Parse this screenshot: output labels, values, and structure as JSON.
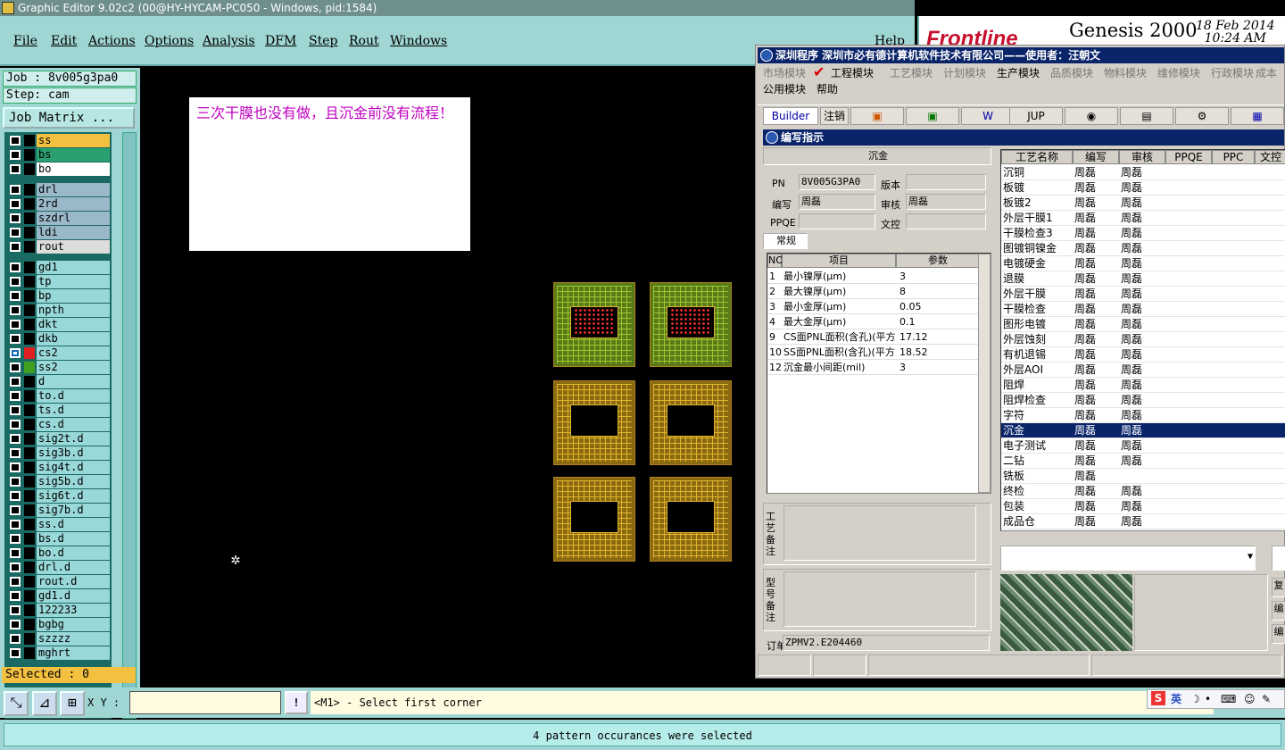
{
  "window": {
    "title": "Graphic Editor 9.02c2 (00@HY-HYCAM-PC050 - Windows, pid:1584)"
  },
  "menu": {
    "items": [
      "File",
      "Edit",
      "Actions",
      "Options",
      "Analysis",
      "DFM",
      "Step",
      "Rout",
      "Windows"
    ],
    "help": "Help"
  },
  "logo": {
    "brand": "Frontline",
    "product": "Genesis 2000",
    "date": "18 Feb 2014",
    "time": "10:24 AM"
  },
  "job": {
    "job_label": "Job : 8v005g3pa0",
    "step_label": "Step: cam",
    "matrix_button": "Job Matrix ..."
  },
  "layers": [
    {
      "name": "ss",
      "color": "#000000",
      "name_bg": "#f4c040"
    },
    {
      "name": "bs",
      "color": "#000000",
      "name_bg": "#2aa070"
    },
    {
      "name": "bo",
      "color": "#000000",
      "name_bg": "#ffffff"
    },
    {
      "name": "drl",
      "color": "#000000",
      "name_bg": "#9ab8c8"
    },
    {
      "name": "2rd",
      "color": "#000000",
      "name_bg": "#9ab8c8"
    },
    {
      "name": "szdrl",
      "color": "#000000",
      "name_bg": "#9ab8c8"
    },
    {
      "name": "ldi",
      "color": "#000000",
      "name_bg": "#9ab8c8"
    },
    {
      "name": "rout",
      "color": "#000000",
      "name_bg": "#dddddd"
    },
    {
      "name": "gd1",
      "color": "#000000",
      "name_bg": "#99d8d8"
    },
    {
      "name": "tp",
      "color": "#000000",
      "name_bg": "#99d8d8"
    },
    {
      "name": "bp",
      "color": "#000000",
      "name_bg": "#99d8d8"
    },
    {
      "name": "npth",
      "color": "#000000",
      "name_bg": "#99d8d8"
    },
    {
      "name": "dkt",
      "color": "#000000",
      "name_bg": "#99d8d8"
    },
    {
      "name": "dkb",
      "color": "#000000",
      "name_bg": "#99d8d8"
    },
    {
      "name": "cs2",
      "color": "#e02020",
      "name_bg": "#99d8d8",
      "selected": true
    },
    {
      "name": "ss2",
      "color": "#40a020",
      "name_bg": "#99d8d8"
    },
    {
      "name": "d",
      "color": "#000000",
      "name_bg": "#99d8d8"
    },
    {
      "name": "to.d",
      "color": "#000000",
      "name_bg": "#99d8d8"
    },
    {
      "name": "ts.d",
      "color": "#000000",
      "name_bg": "#99d8d8"
    },
    {
      "name": "cs.d",
      "color": "#000000",
      "name_bg": "#99d8d8"
    },
    {
      "name": "sig2t.d",
      "color": "#000000",
      "name_bg": "#99d8d8"
    },
    {
      "name": "sig3b.d",
      "color": "#000000",
      "name_bg": "#99d8d8"
    },
    {
      "name": "sig4t.d",
      "color": "#000000",
      "name_bg": "#99d8d8"
    },
    {
      "name": "sig5b.d",
      "color": "#000000",
      "name_bg": "#99d8d8"
    },
    {
      "name": "sig6t.d",
      "color": "#000000",
      "name_bg": "#99d8d8"
    },
    {
      "name": "sig7b.d",
      "color": "#000000",
      "name_bg": "#99d8d8"
    },
    {
      "name": "ss.d",
      "color": "#000000",
      "name_bg": "#99d8d8"
    },
    {
      "name": "bs.d",
      "color": "#000000",
      "name_bg": "#99d8d8"
    },
    {
      "name": "bo.d",
      "color": "#000000",
      "name_bg": "#99d8d8"
    },
    {
      "name": "drl.d",
      "color": "#000000",
      "name_bg": "#99d8d8"
    },
    {
      "name": "rout.d",
      "color": "#000000",
      "name_bg": "#99d8d8"
    },
    {
      "name": "gd1.d",
      "color": "#000000",
      "name_bg": "#99d8d8"
    },
    {
      "name": "122233",
      "color": "#000000",
      "name_bg": "#99d8d8"
    },
    {
      "name": "bgbg",
      "color": "#000000",
      "name_bg": "#99d8d8"
    },
    {
      "name": "szzzz",
      "color": "#000000",
      "name_bg": "#99d8d8"
    },
    {
      "name": "mghrt",
      "color": "#000000",
      "name_bg": "#99d8d8"
    }
  ],
  "selected": {
    "label": "Selected : 0"
  },
  "note": {
    "text": "三次干膜也没有做，且沉金前没有流程！"
  },
  "command": {
    "xy_label": "X Y :",
    "xy_value": "",
    "bang": "!",
    "prompt": "<M1> - Select first corner",
    "ime": "英"
  },
  "status": {
    "message": "4 pattern occurances were selected"
  },
  "overlay": {
    "title": "深圳程序   深圳市必有德计算机软件技术有限公司——使用者：汪朝文",
    "menu_row1": [
      "市场模块",
      "工程模块",
      "工艺模块",
      "计划模块",
      "生产模块",
      "品质模块",
      "物料模块",
      "维修模块",
      "行政模块",
      "成本"
    ],
    "menu_row2": [
      "公用模块",
      "帮助"
    ],
    "toolbar": [
      "Builder",
      "注销",
      "JUP"
    ],
    "subwin_title": "编写指示",
    "process_name": "沉金",
    "form": {
      "pn_label": "PN",
      "pn_value": "8V005G3PA0",
      "version_label": "版本",
      "version_value": "",
      "writer_label": "编写",
      "writer_value": "周磊",
      "review_label": "审核",
      "review_value": "周磊",
      "ppqe_label": "PPQE",
      "ppqe_value": "",
      "doc_label": "文控",
      "doc_value": "",
      "tab": "常规"
    },
    "params_headers": [
      "NO",
      "项目",
      "参数"
    ],
    "params": [
      {
        "no": "1",
        "item": "最小镍厚(μm)",
        "value": "3"
      },
      {
        "no": "2",
        "item": "最大镍厚(μm)",
        "value": "8"
      },
      {
        "no": "3",
        "item": "最小金厚(μm)",
        "value": "0.05"
      },
      {
        "no": "4",
        "item": "最大金厚(μm)",
        "value": "0.1"
      },
      {
        "no": "9",
        "item": "CS面PNL面积(含孔)(平方",
        "value": "17.12"
      },
      {
        "no": "10",
        "item": "SS面PNL面积(含孔)(平方",
        "value": "18.52"
      },
      {
        "no": "12",
        "item": "沉金最小间距(mil)",
        "value": "3"
      }
    ],
    "remark_process": "工艺备注",
    "remark_model": "型号备注",
    "order_label": "订单",
    "order_value": "ZPMV2.E204460",
    "steps_headers": [
      "工艺名称",
      "编写",
      "审核",
      "PPQE",
      "PPC",
      "文控"
    ],
    "steps": [
      {
        "name": "沉铜",
        "writer": "周磊",
        "reviewer": "周磊"
      },
      {
        "name": "板镀",
        "writer": "周磊",
        "reviewer": "周磊"
      },
      {
        "name": "板镀2",
        "writer": "周磊",
        "reviewer": "周磊"
      },
      {
        "name": "外层干膜1",
        "writer": "周磊",
        "reviewer": "周磊"
      },
      {
        "name": "干膜检查3",
        "writer": "周磊",
        "reviewer": "周磊"
      },
      {
        "name": "图镀铜镍金",
        "writer": "周磊",
        "reviewer": "周磊"
      },
      {
        "name": "电镀硬金",
        "writer": "周磊",
        "reviewer": "周磊"
      },
      {
        "name": "退膜",
        "writer": "周磊",
        "reviewer": "周磊"
      },
      {
        "name": "外层干膜",
        "writer": "周磊",
        "reviewer": "周磊"
      },
      {
        "name": "干膜检查",
        "writer": "周磊",
        "reviewer": "周磊"
      },
      {
        "name": "图形电镀",
        "writer": "周磊",
        "reviewer": "周磊"
      },
      {
        "name": "外层蚀刻",
        "writer": "周磊",
        "reviewer": "周磊"
      },
      {
        "name": "有机退锡",
        "writer": "周磊",
        "reviewer": "周磊"
      },
      {
        "name": "外层AOI",
        "writer": "周磊",
        "reviewer": "周磊"
      },
      {
        "name": "阻焊",
        "writer": "周磊",
        "reviewer": "周磊"
      },
      {
        "name": "阻焊检查",
        "writer": "周磊",
        "reviewer": "周磊"
      },
      {
        "name": "字符",
        "writer": "周磊",
        "reviewer": "周磊"
      },
      {
        "name": "沉金",
        "writer": "周磊",
        "reviewer": "周磊",
        "selected": true
      },
      {
        "name": "电子测试",
        "writer": "周磊",
        "reviewer": "周磊"
      },
      {
        "name": "二钻",
        "writer": "周磊",
        "reviewer": "周磊"
      },
      {
        "name": "铣板",
        "writer": "周磊",
        "reviewer": ""
      },
      {
        "name": "终检",
        "writer": "周磊",
        "reviewer": "周磊"
      },
      {
        "name": "包装",
        "writer": "周磊",
        "reviewer": "周磊"
      },
      {
        "name": "成品仓",
        "writer": "周磊",
        "reviewer": "周磊"
      }
    ],
    "side_buttons": [
      "复",
      "编",
      "编"
    ]
  }
}
